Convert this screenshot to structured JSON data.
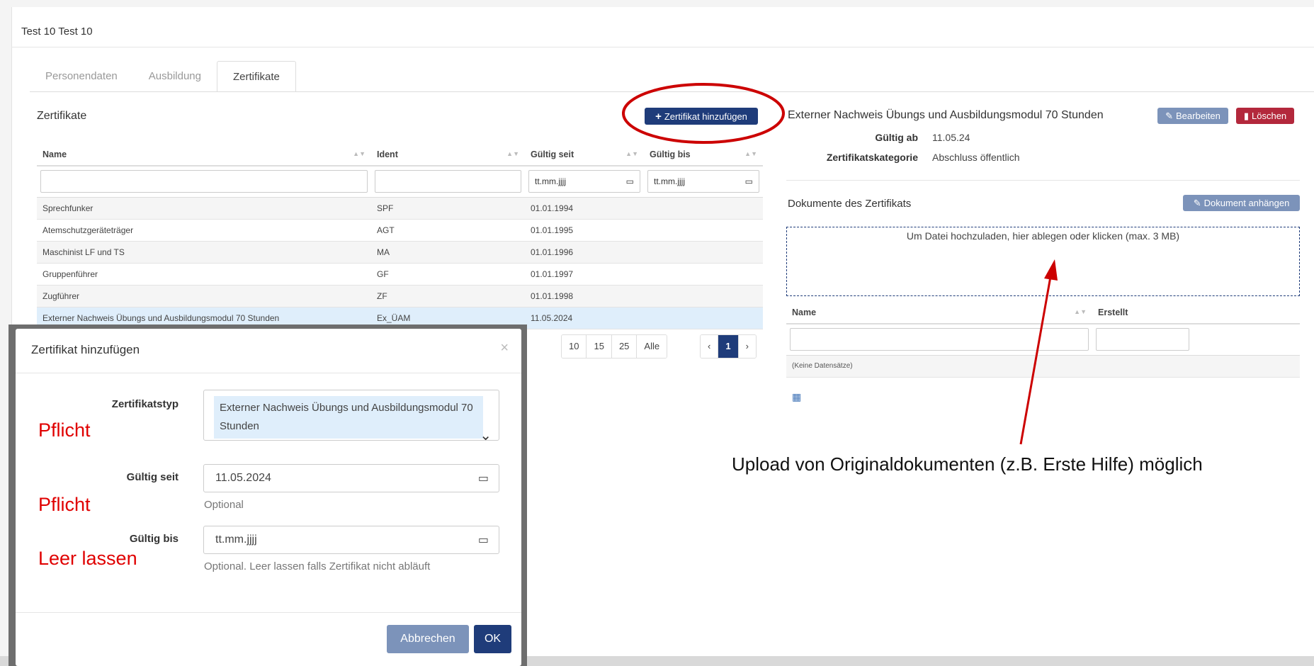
{
  "person": {
    "title": "Test 10 Test 10"
  },
  "tabs": [
    {
      "label": "Personendaten",
      "active": false
    },
    {
      "label": "Ausbildung",
      "active": false
    },
    {
      "label": "Zertifikate",
      "active": true
    }
  ],
  "list": {
    "title": "Zertifikate",
    "add_button": "Zertifikat hinzufügen",
    "columns": [
      "Name",
      "Ident",
      "Gültig seit",
      "Gültig bis"
    ],
    "filters": {
      "name": "",
      "ident": "",
      "from_placeholder": "tt.mm.jjjj",
      "to_placeholder": "tt.mm.jjjj"
    },
    "rows": [
      {
        "name": "Sprechfunker",
        "ident": "SPF",
        "from": "01.01.1994",
        "to": ""
      },
      {
        "name": "Atemschutzgeräteträger",
        "ident": "AGT",
        "from": "01.01.1995",
        "to": ""
      },
      {
        "name": "Maschinist LF und TS",
        "ident": "MA",
        "from": "01.01.1996",
        "to": ""
      },
      {
        "name": "Gruppenführer",
        "ident": "GF",
        "from": "01.01.1997",
        "to": ""
      },
      {
        "name": "Zugführer",
        "ident": "ZF",
        "from": "01.01.1998",
        "to": ""
      },
      {
        "name": "Externer Nachweis Übungs und Ausbildungsmodul 70 Stunden",
        "ident": "Ex_ÜAM",
        "from": "11.05.2024",
        "to": ""
      }
    ],
    "page_sizes": [
      "10",
      "15",
      "25",
      "Alle"
    ],
    "pager": {
      "prev": "‹",
      "current": "1",
      "next": "›"
    }
  },
  "detail": {
    "title": "Externer Nachweis Übungs und Ausbildungsmodul 70 Stunden",
    "edit_button": "Bearbeiten",
    "delete_button": "Löschen",
    "valid_from_label": "Gültig ab",
    "valid_from_value": "11.05.24",
    "category_label": "Zertifikatskategorie",
    "category_value": "Abschluss öffentlich",
    "documents_title": "Dokumente des Zertifikats",
    "attach_button": "Dokument anhängen",
    "dropzone_text": "Um Datei hochzuladen, hier ablegen oder klicken (max. 3 MB)",
    "doc_columns": [
      "Name",
      "Erstellt"
    ],
    "no_records": "(Keine Datensätze)"
  },
  "modal": {
    "title": "Zertifikat hinzufügen",
    "close": "×",
    "type_label": "Zertifikatstyp",
    "type_value": "Externer Nachweis Übungs und Ausbildungsmodul 70 Stunden",
    "from_label": "Gültig seit",
    "from_value": "11.05.2024",
    "from_help": "Optional",
    "to_label": "Gültig bis",
    "to_placeholder": "tt.mm.jjjj",
    "to_help": "Optional. Leer lassen falls Zertifikat nicht abläuft",
    "cancel_button": "Abbrechen",
    "ok_button": "OK"
  },
  "annotations": {
    "type_note": "Pflicht",
    "from_note": "Pflicht",
    "to_note": "Leer lassen",
    "upload_note": "Upload von Originaldokumenten (z.B. Erste Hilfe) möglich",
    "color": "#e00000",
    "highlight_circle_color": "#cc0000"
  },
  "colors": {
    "primary": "#1f3c7a",
    "secondary": "#7c93ba",
    "danger": "#b3283c",
    "selected_row": "#dfeefb"
  }
}
